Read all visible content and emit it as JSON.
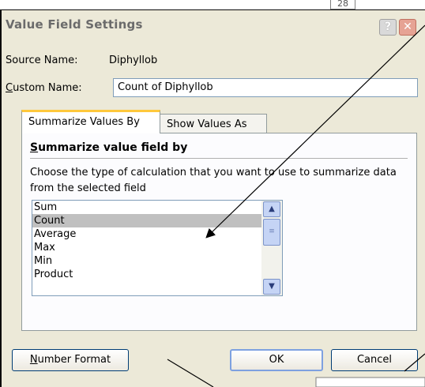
{
  "background": {
    "cell_value": "28"
  },
  "dialog": {
    "title": "Value Field Settings",
    "help_glyph": "?",
    "close_glyph": "✕",
    "source_name_label": "Source Name:",
    "source_name_value": "Diphyllob",
    "custom_name_label_first": "C",
    "custom_name_label_rest": "ustom Name:",
    "custom_name_value": "Count of Diphyllob",
    "tabs": [
      {
        "label": "Summarize Values By",
        "active": true
      },
      {
        "label": "Show Values As",
        "active": false
      }
    ],
    "section_heading_first": "S",
    "section_heading_rest": "ummarize value field by",
    "description": "Choose the type of calculation that you want to use to summarize data from the selected field",
    "functions": [
      "Sum",
      "Count",
      "Average",
      "Max",
      "Min",
      "Product"
    ],
    "selected_function": "Count",
    "scroll_up_glyph": "▲",
    "scroll_down_glyph": "▼",
    "scroll_thumb_glyph": "≡",
    "buttons": {
      "number_format_first": "N",
      "number_format_rest": "umber Format",
      "ok": "OK",
      "cancel": "Cancel"
    }
  },
  "colors": {
    "dialog_bg": "#ece9d8",
    "tab_highlight": "#ffc83c",
    "selection": "#c0c0c0",
    "close_button": "#e6a394"
  }
}
